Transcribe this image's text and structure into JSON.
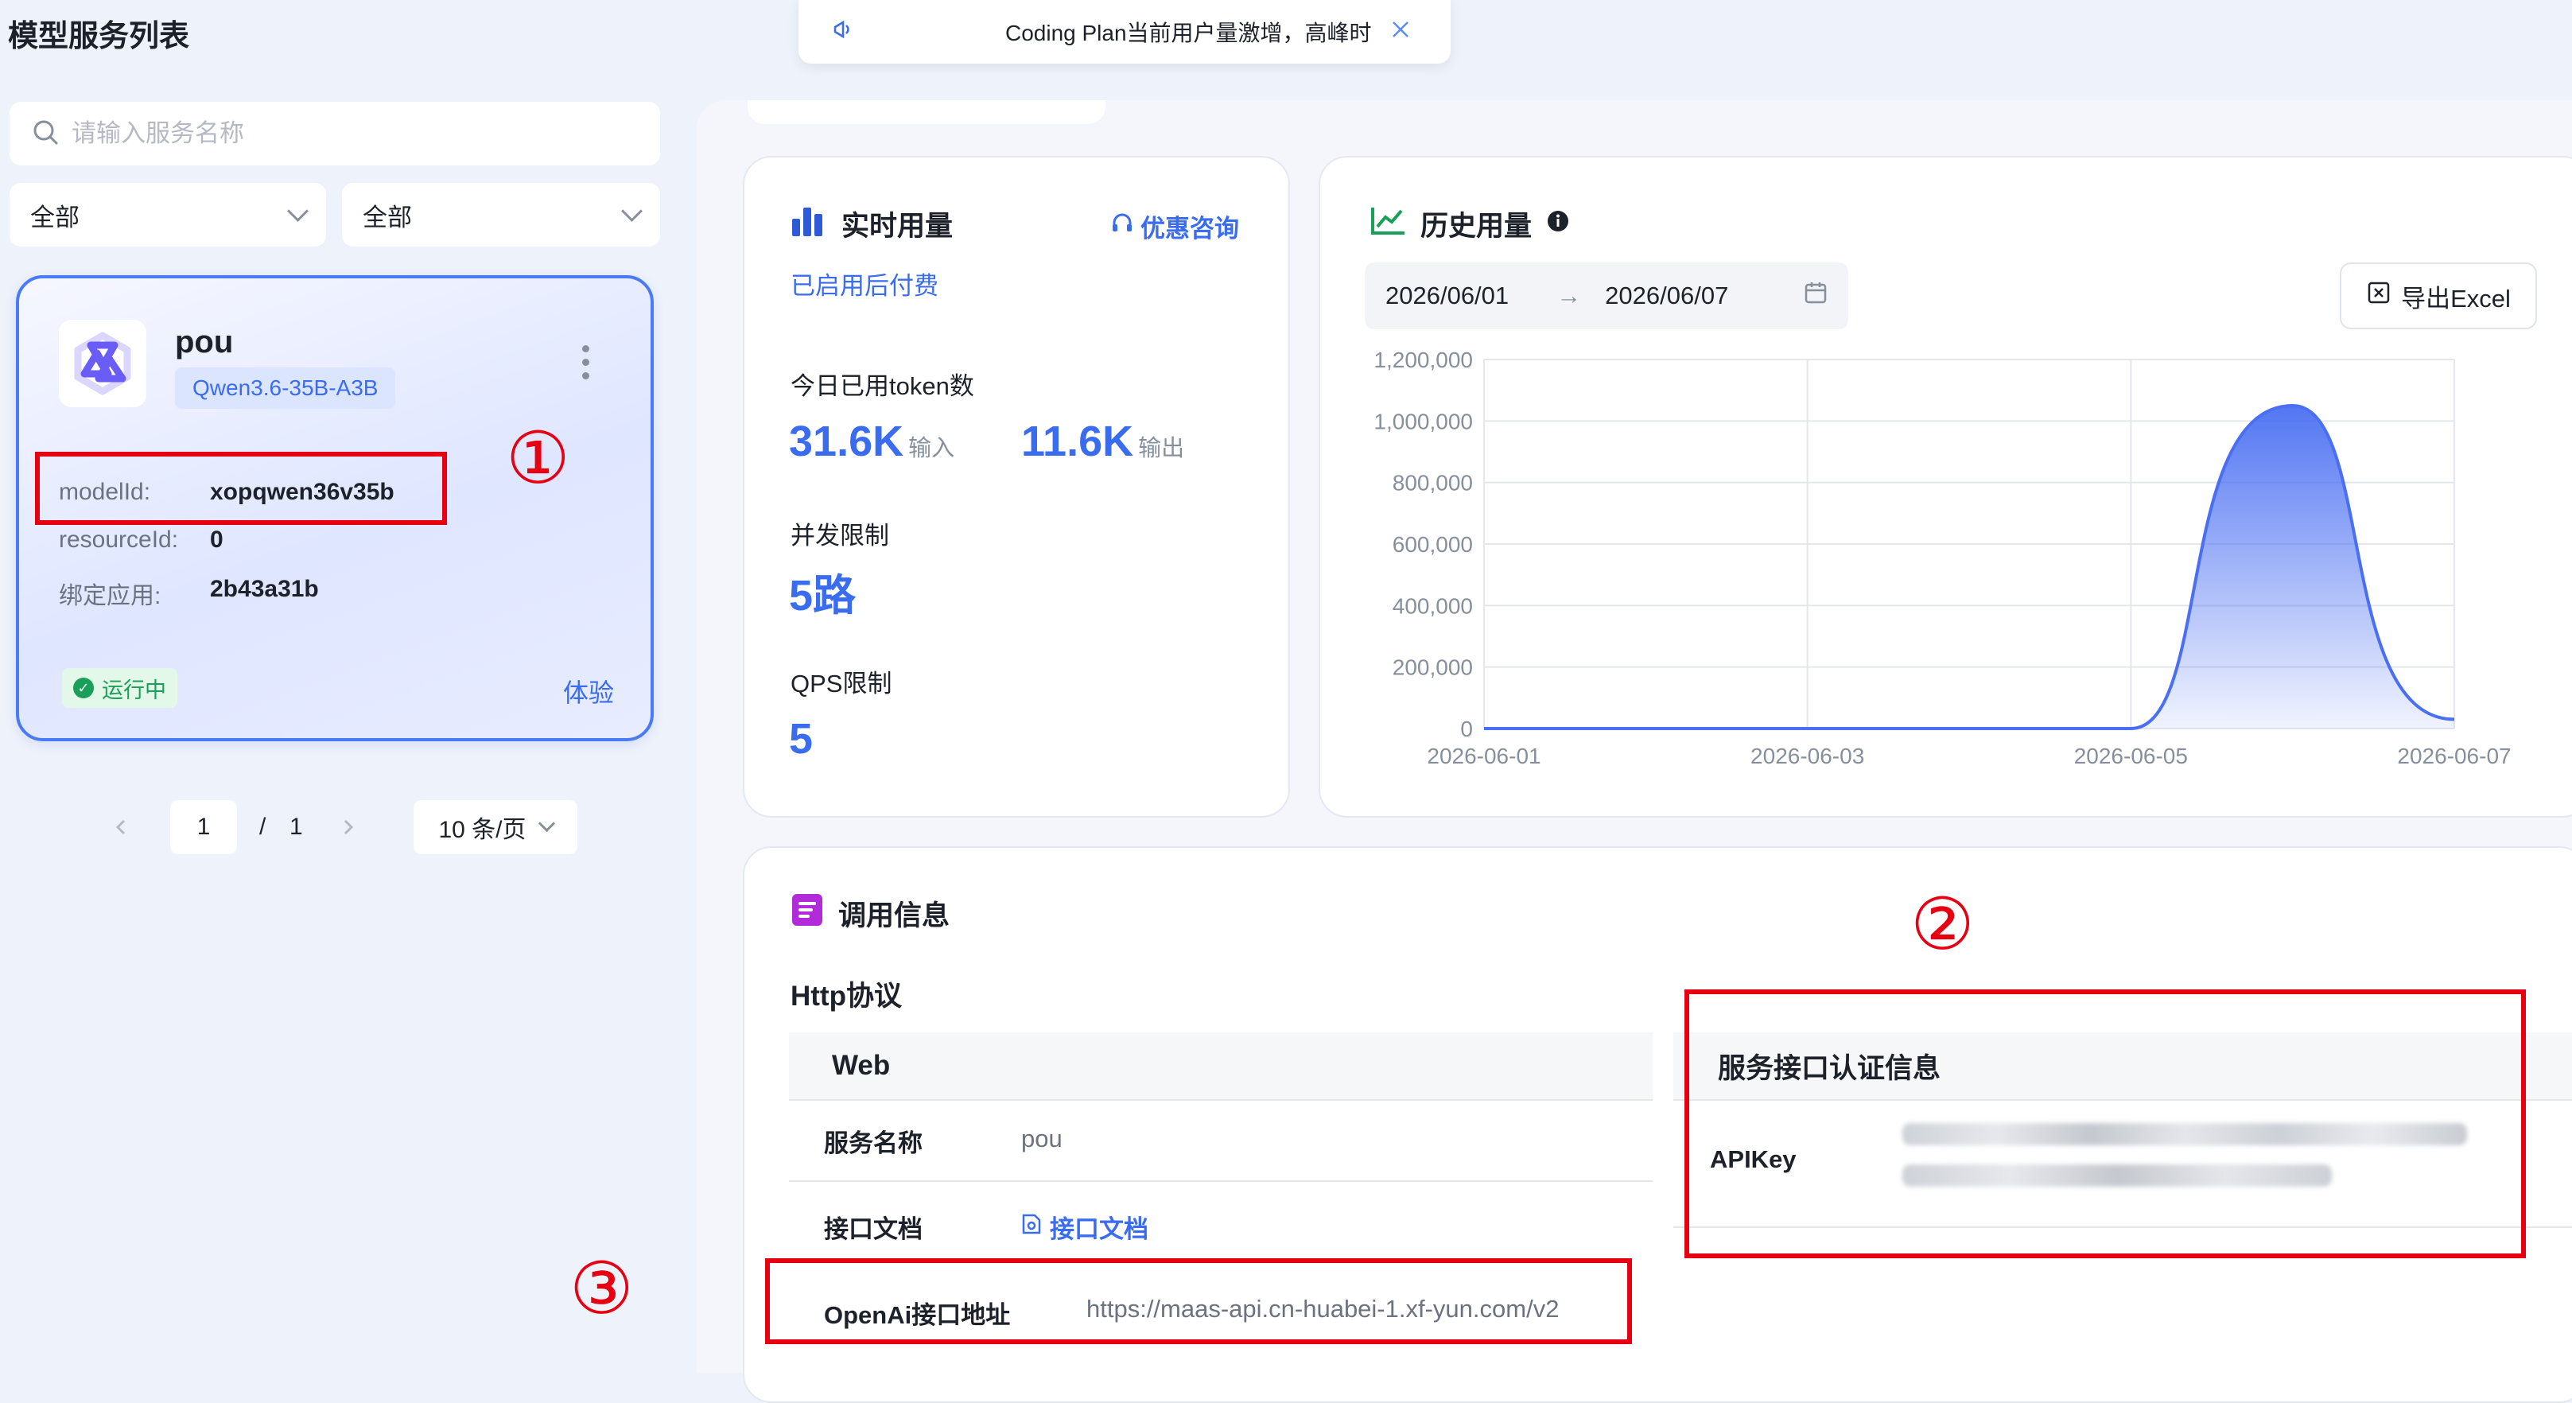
{
  "page_title": "模型服务列表",
  "search": {
    "placeholder": "请输入服务名称"
  },
  "filters": [
    {
      "value": "全部"
    },
    {
      "value": "全部"
    }
  ],
  "service_card": {
    "name": "pou",
    "model_tag": "Qwen3.6-35B-A3B",
    "fields": [
      {
        "label": "modelId:",
        "value": "xopqwen36v35b"
      },
      {
        "label": "resourceId:",
        "value": "0"
      },
      {
        "label": "绑定应用:",
        "value": "2b43a31b"
      }
    ],
    "status": "运行中",
    "try_label": "体验"
  },
  "pagination": {
    "current": "1",
    "separator": "/",
    "total": "1",
    "page_size": "10 条/页"
  },
  "toast": {
    "text": "Coding Plan当前用户量激增，高峰时段"
  },
  "realtime": {
    "title": "实时用量",
    "consult_label": "优惠咨询",
    "billing_status": "已启用后付费",
    "token_label": "今日已用token数",
    "input_value": "31.6K",
    "input_unit": "输入",
    "output_value": "11.6K",
    "output_unit": "输出",
    "concurrency_label": "并发限制",
    "concurrency_value": "5路",
    "qps_label": "QPS限制",
    "qps_value": "5"
  },
  "history": {
    "title": "历史用量",
    "start_date": "2026/06/01",
    "arrow": "→",
    "end_date": "2026/06/07",
    "export_label": "导出Excel"
  },
  "chart_data": {
    "type": "area",
    "x": [
      "2026-06-01",
      "2026-06-02",
      "2026-06-03",
      "2026-06-04",
      "2026-06-05",
      "2026-06-06",
      "2026-06-07"
    ],
    "x_ticks": [
      "2026-06-01",
      "2026-06-03",
      "2026-06-05",
      "2026-06-07"
    ],
    "y_ticks": [
      "1,200,000",
      "1,000,000",
      "800,000",
      "600,000",
      "400,000",
      "200,000",
      "0"
    ],
    "ylim": [
      0,
      1200000
    ],
    "series": [
      {
        "values": [
          0,
          0,
          0,
          0,
          0,
          1050000,
          30000
        ]
      }
    ],
    "grid": true,
    "color": "#4a6ff2"
  },
  "invoke": {
    "title": "调用信息",
    "protocol": "Http协议",
    "web_header": "Web",
    "rows": [
      {
        "label": "服务名称",
        "value": "pou"
      },
      {
        "label": "接口文档",
        "value": "接口文档"
      },
      {
        "label": "OpenAi接口地址",
        "value": "https://maas-api.cn-huabei-1.xf-yun.com/v2"
      }
    ],
    "auth_header": "服务接口认证信息",
    "apikey_label": "APIKey"
  },
  "annotations": {
    "n1": "①",
    "n2": "②",
    "n3": "③"
  },
  "colors": {
    "accent": "#3a6cf0",
    "annotation": "#e60012",
    "success": "#18a058"
  }
}
